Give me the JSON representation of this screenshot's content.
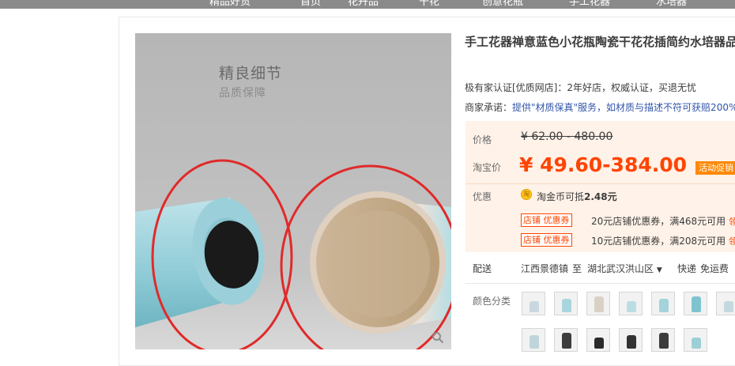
{
  "nav": {
    "items": [
      "精品好货",
      "首页",
      "花卉品",
      "干花",
      "创意花瓶",
      "手工花器",
      "水培器"
    ]
  },
  "product": {
    "title": "手工花器禅意蓝色小花瓶陶瓷干花花插简约水培器品",
    "image_title": "精良细节",
    "image_subtitle": "品质保障",
    "certification": "极有家认证[优质网店]：2年好店，权威认证，买退无忧",
    "promise_label": "商家承诺：",
    "promise_link": "提供\"材质保真\"服务，如材质与描述不符可获赔200%"
  },
  "pricing": {
    "price_label": "价格",
    "original_price": "¥ 62.00 - 480.00",
    "promo_label": "淘宝价",
    "promo_price": "¥ 49.60-384.00",
    "promo_badge": "活动促销",
    "discount_label": "优惠",
    "coin_icon_text": "淘",
    "coin_text_prefix": "淘金币可抵",
    "coin_amount": "2.48元",
    "coupons": [
      {
        "tag": "店铺 优惠券",
        "text": "20元店铺优惠券，满468元可用",
        "action": "领"
      },
      {
        "tag": "店铺 优惠券",
        "text": "10元店铺优惠券，满208元可用",
        "action": "领"
      }
    ]
  },
  "shipping": {
    "label": "配送",
    "from": "江西景德镇",
    "to_word": "至",
    "destination": "湖北武汉洪山区",
    "method": "快递",
    "fee": "免运费"
  },
  "options": {
    "color_label": "颜色分类",
    "swatch_colors": [
      "#c9d8df",
      "#a9d6de",
      "#d9d2c4",
      "#b9dde3",
      "#a4d3dc",
      "#7fc3d0",
      "#c3d9de",
      "#bfd5dc",
      "#3c3c3c",
      "#2a2a2a",
      "#323232",
      "#3b3b3b",
      "#9ccfd6"
    ]
  }
}
